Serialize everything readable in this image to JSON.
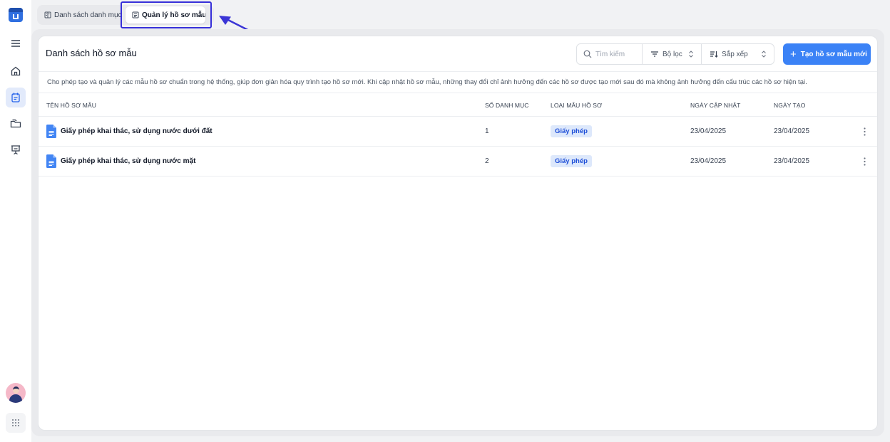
{
  "tabs": [
    {
      "label": "Danh sách danh mục"
    },
    {
      "label": "Quản lý hồ sơ mẫu"
    }
  ],
  "page": {
    "title": "Danh sách hồ sơ mẫu",
    "description": "Cho phép tạo và quản lý các mẫu hồ sơ chuẩn trong hệ thống, giúp đơn giản hóa quy trình tạo hồ sơ mới. Khi cập nhật hồ sơ mẫu, những thay đổi chỉ ảnh hưởng đến các hồ sơ được tạo mới sau đó mà không ảnh hưởng đến cấu trúc các hồ sơ hiện tại."
  },
  "toolbar": {
    "search_placeholder": "Tìm kiếm",
    "filter_label": "Bộ lọc",
    "sort_label": "Sắp xếp",
    "create_label": "Tạo hồ sơ mẫu mới"
  },
  "table": {
    "headers": [
      "Tên hồ sơ mẫu",
      "Số danh mục",
      "Loại mẫu hồ sơ",
      "Ngày cập nhật",
      "Ngày tạo"
    ],
    "rows": [
      {
        "name": "Giấy phép khai thác, sử dụng nước dưới đất",
        "count": "1",
        "type": "Giấy phép",
        "updated": "23/04/2025",
        "created": "23/04/2025"
      },
      {
        "name": "Giấy phép khai thác, sử dụng nước mặt",
        "count": "2",
        "type": "Giấy phép",
        "updated": "23/04/2025",
        "created": "23/04/2025"
      }
    ]
  },
  "colors": {
    "accent": "#3b82f6",
    "highlight": "#3730d9",
    "badge_bg": "#dde8fb",
    "badge_text": "#1d4ed8"
  },
  "icons": {
    "sidebar": [
      "menu-icon",
      "home-icon",
      "calendar-icon",
      "folders-icon",
      "presentation-icon"
    ],
    "tabs": [
      "ledger-icon",
      "document-list-icon"
    ],
    "toolbar": [
      "search-icon",
      "filter-icon",
      "sort-icon",
      "chevron-updown-icon",
      "plus-icon"
    ],
    "row": [
      "document-icon",
      "more-vertical-icon"
    ]
  }
}
